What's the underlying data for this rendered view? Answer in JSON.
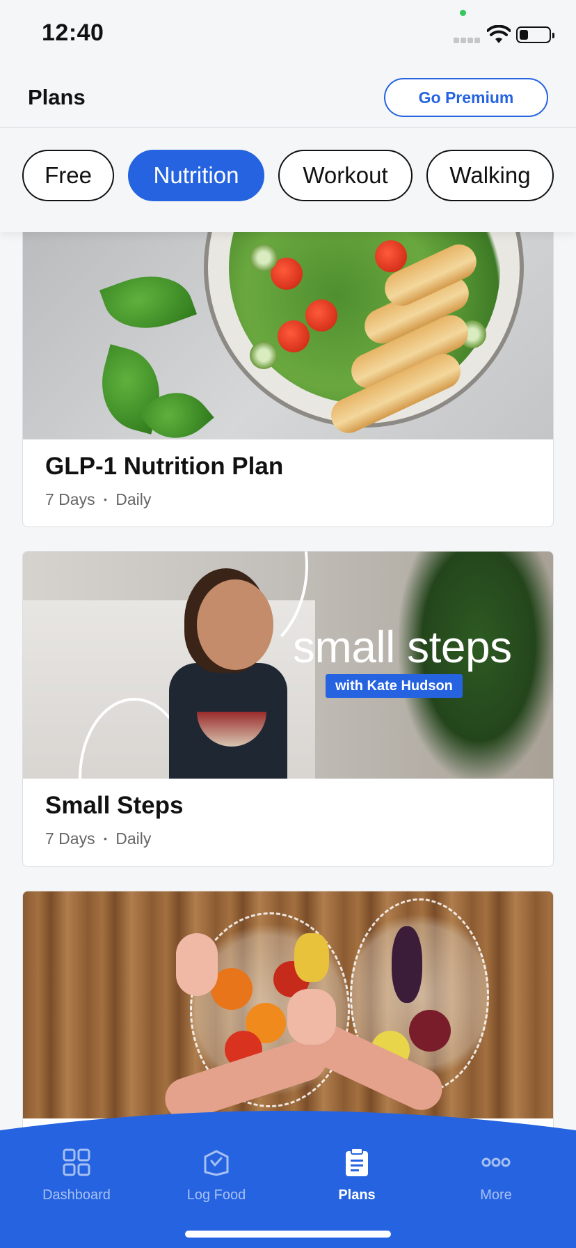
{
  "status_bar": {
    "time": "12:40"
  },
  "header": {
    "title": "Plans",
    "premium_label": "Go Premium"
  },
  "filters": [
    {
      "label": "Free",
      "active": false
    },
    {
      "label": "Nutrition",
      "active": true
    },
    {
      "label": "Workout",
      "active": false
    },
    {
      "label": "Walking",
      "active": false
    }
  ],
  "plans": [
    {
      "title": "GLP-1 Nutrition Plan",
      "duration": "7 Days",
      "frequency": "Daily",
      "image": "salad-with-chicken"
    },
    {
      "title": "Small Steps",
      "duration": "7 Days",
      "frequency": "Daily",
      "image": "woman-eating-bowl",
      "image_text": "small steps",
      "image_subtext": "with Kate Hudson"
    },
    {
      "title": "",
      "image": "grocery-bags-with-fruit"
    }
  ],
  "meta_separator": "•",
  "bottom_nav": [
    {
      "label": "Dashboard",
      "icon": "grid-icon",
      "active": false
    },
    {
      "label": "Log Food",
      "icon": "log-food-icon",
      "active": false
    },
    {
      "label": "Plans",
      "icon": "clipboard-icon",
      "active": true
    },
    {
      "label": "More",
      "icon": "more-dots-icon",
      "active": false
    }
  ],
  "colors": {
    "accent": "#2563e0",
    "background": "#f5f6f8"
  }
}
